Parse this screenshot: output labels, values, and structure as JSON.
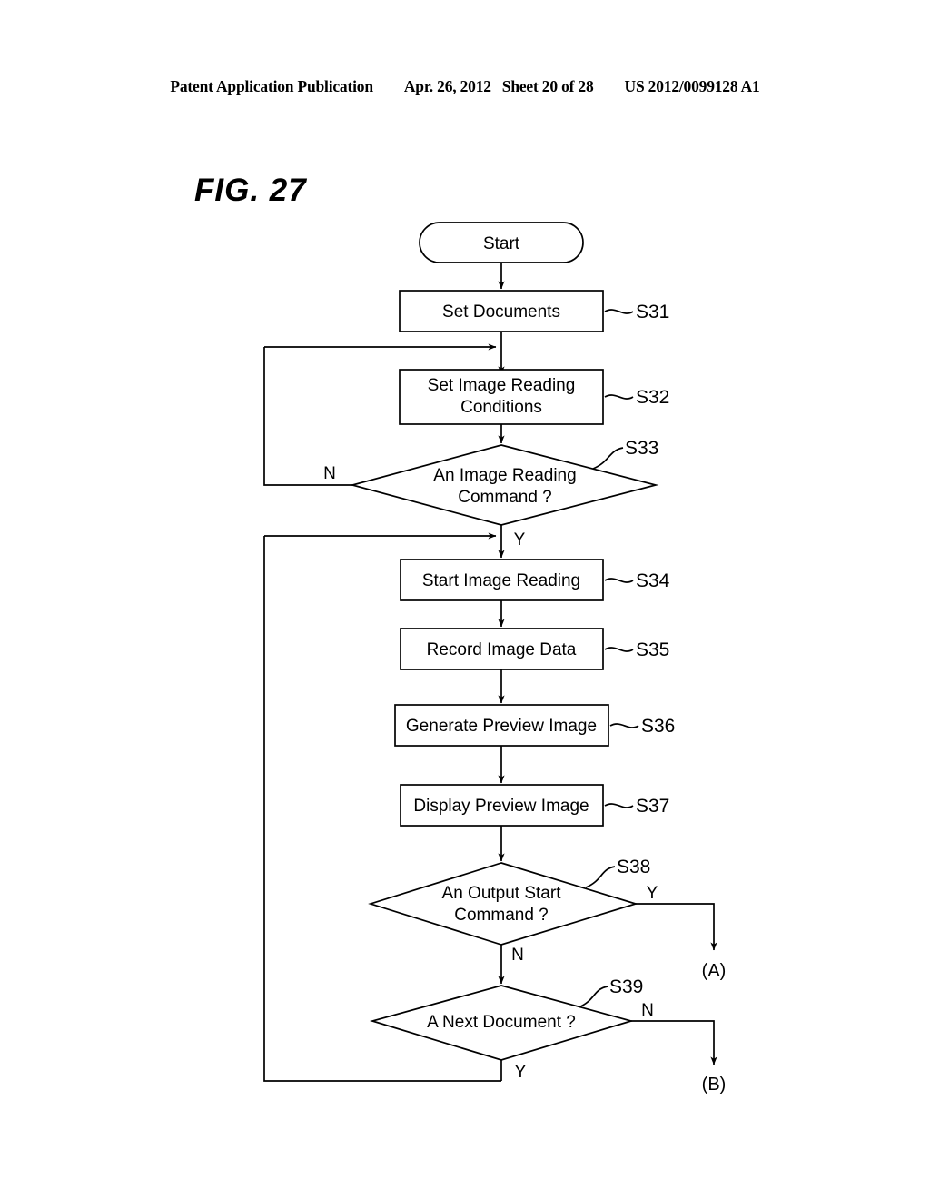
{
  "header": {
    "publication": "Patent Application Publication",
    "date": "Apr. 26, 2012",
    "sheet": "Sheet 20 of 28",
    "patent_number": "US 2012/0099128 A1"
  },
  "figure": {
    "title": "FIG. 27"
  },
  "flowchart": {
    "terminal_start": "Start",
    "nodes": [
      {
        "id": "S31",
        "text": "Set Documents",
        "type": "process",
        "step": "S31"
      },
      {
        "id": "S32",
        "text_line1": "Set Image Reading",
        "text_line2": "Conditions",
        "type": "process",
        "step": "S32"
      },
      {
        "id": "S33",
        "text_line1": "An Image Reading",
        "text_line2": "Command ?",
        "type": "decision",
        "step": "S33"
      },
      {
        "id": "S34",
        "text": "Start Image Reading",
        "type": "process",
        "step": "S34"
      },
      {
        "id": "S35",
        "text": "Record Image Data",
        "type": "process",
        "step": "S35"
      },
      {
        "id": "S36",
        "text": "Generate Preview Image",
        "type": "process",
        "step": "S36"
      },
      {
        "id": "S37",
        "text": "Display Preview Image",
        "type": "process",
        "step": "S37"
      },
      {
        "id": "S38",
        "text_line1": "An Output Start",
        "text_line2": "Command ?",
        "type": "decision",
        "step": "S38"
      },
      {
        "id": "S39",
        "text": "A Next Document ?",
        "type": "decision",
        "step": "S39"
      }
    ],
    "branch_labels": {
      "s33_no": "N",
      "s33_yes": "Y",
      "s38_yes": "Y",
      "s38_no": "N",
      "s39_no": "N",
      "s39_yes": "Y"
    },
    "connectors": [
      {
        "id": "A",
        "label": "(A)"
      },
      {
        "id": "B",
        "label": "(B)"
      }
    ],
    "colors": {
      "line": "#000000",
      "shape_fill": "#ffffff",
      "background": "#ffffff"
    }
  }
}
